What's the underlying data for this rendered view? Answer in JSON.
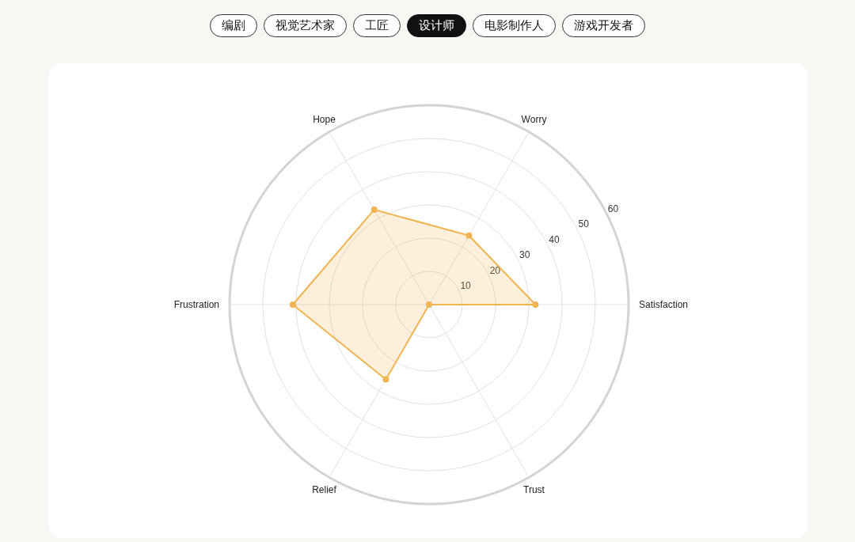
{
  "tabs": [
    {
      "label": "编剧",
      "selected": false
    },
    {
      "label": "视觉艺术家",
      "selected": false
    },
    {
      "label": "工匠",
      "selected": false
    },
    {
      "label": "设计师",
      "selected": true
    },
    {
      "label": "电影制作人",
      "selected": false
    },
    {
      "label": "游戏开发者",
      "selected": false
    }
  ],
  "card": {
    "chart_data": {
      "type": "radar",
      "categories": [
        "Worry",
        "Satisfaction",
        "Trust",
        "Relief",
        "Frustration",
        "Hope"
      ],
      "series": [
        {
          "color": "#f0b552",
          "values": [
            24,
            32,
            0,
            26,
            41,
            33
          ]
        }
      ],
      "ylim": [
        0,
        60
      ],
      "yticks": [
        10,
        20,
        30,
        40,
        50,
        60
      ]
    }
  }
}
